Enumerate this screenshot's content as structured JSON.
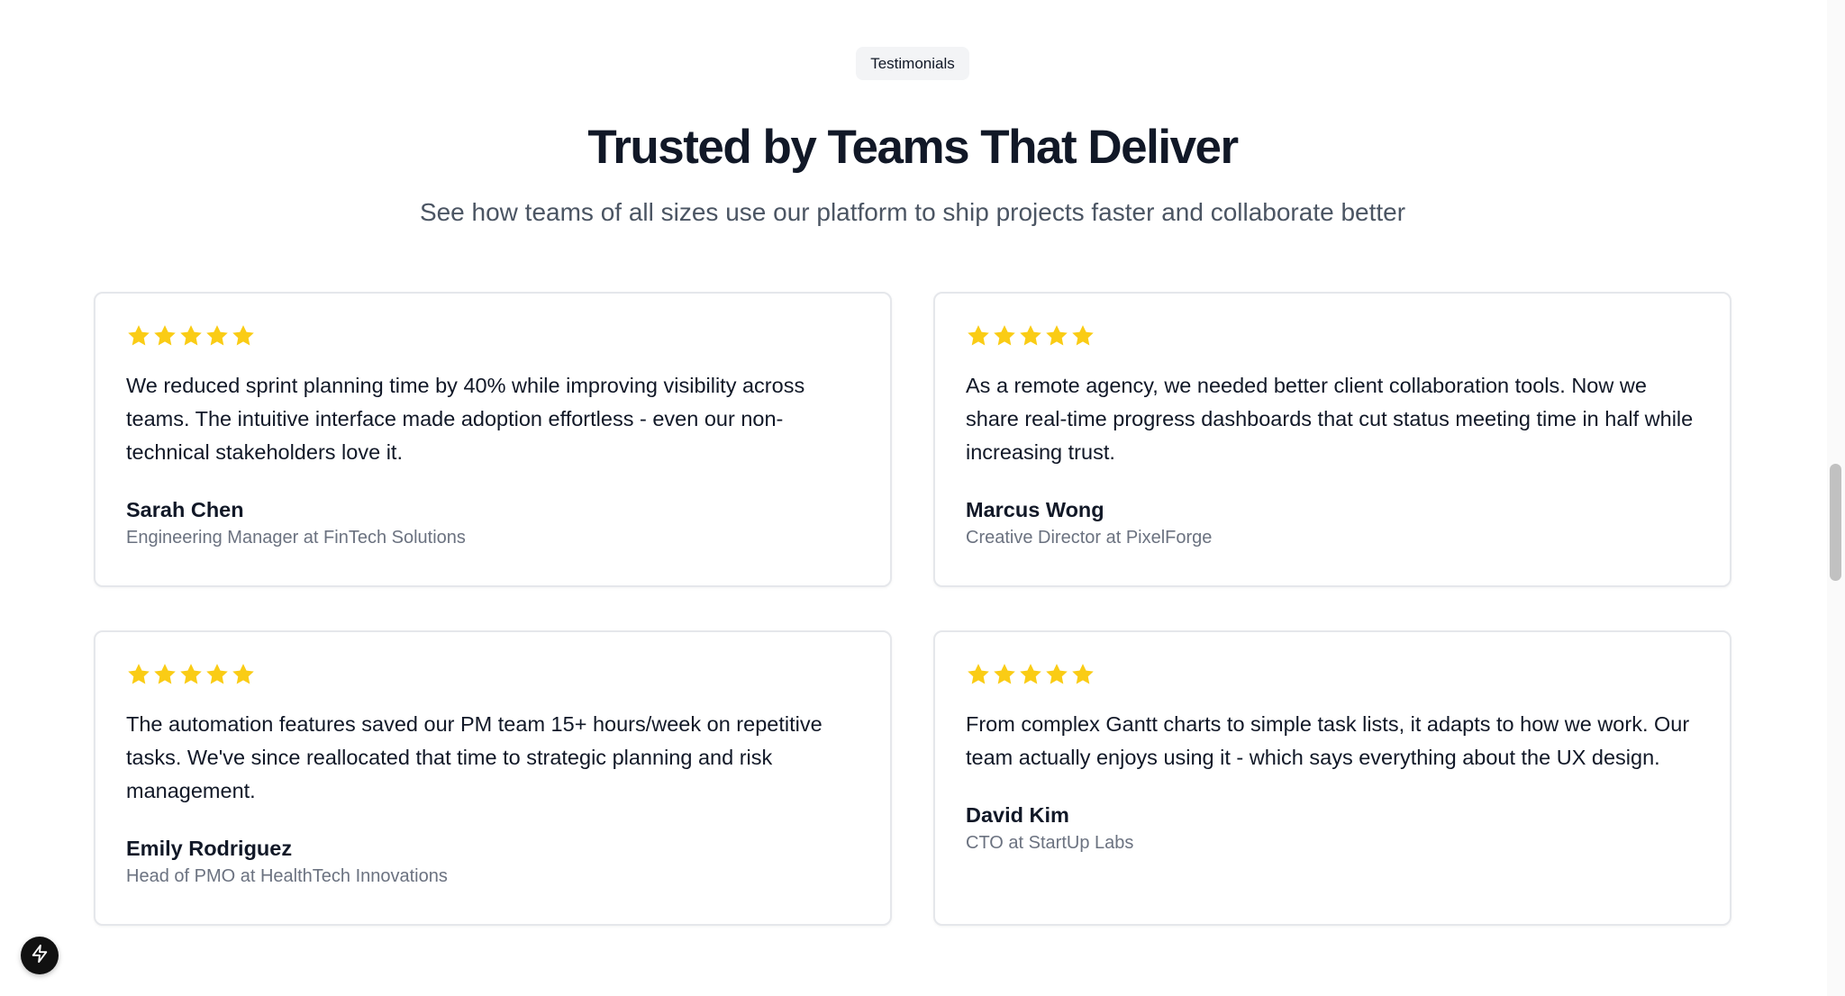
{
  "section": {
    "badge": "Testimonials",
    "title": "Trusted by Teams That Deliver",
    "subtitle": "See how teams of all sizes use our platform to ship projects faster and collaborate better"
  },
  "colors": {
    "star": "#facc15",
    "title": "#111827",
    "subtitle": "#4b5563",
    "role": "#6b7280"
  },
  "testimonials": [
    {
      "rating": 5,
      "quote": "We reduced sprint planning time by 40% while improving visibility across teams. The intuitive interface made adoption effortless - even our non-technical stakeholders love it.",
      "name": "Sarah Chen",
      "role": "Engineering Manager at FinTech Solutions"
    },
    {
      "rating": 5,
      "quote": "As a remote agency, we needed better client collaboration tools. Now we share real-time progress dashboards that cut status meeting time in half while increasing trust.",
      "name": "Marcus Wong",
      "role": "Creative Director at PixelForge"
    },
    {
      "rating": 5,
      "quote": "The automation features saved our PM team 15+ hours/week on repetitive tasks. We've since reallocated that time to strategic planning and risk management.",
      "name": "Emily Rodriguez",
      "role": "Head of PMO at HealthTech Innovations"
    },
    {
      "rating": 5,
      "quote": "From complex Gantt charts to simple task lists, it adapts to how we work. Our team actually enjoys using it - which says everything about the UX design.",
      "name": "David Kim",
      "role": "CTO at StartUp Labs"
    }
  ],
  "fab": {
    "icon": "lightning-bolt-icon"
  }
}
